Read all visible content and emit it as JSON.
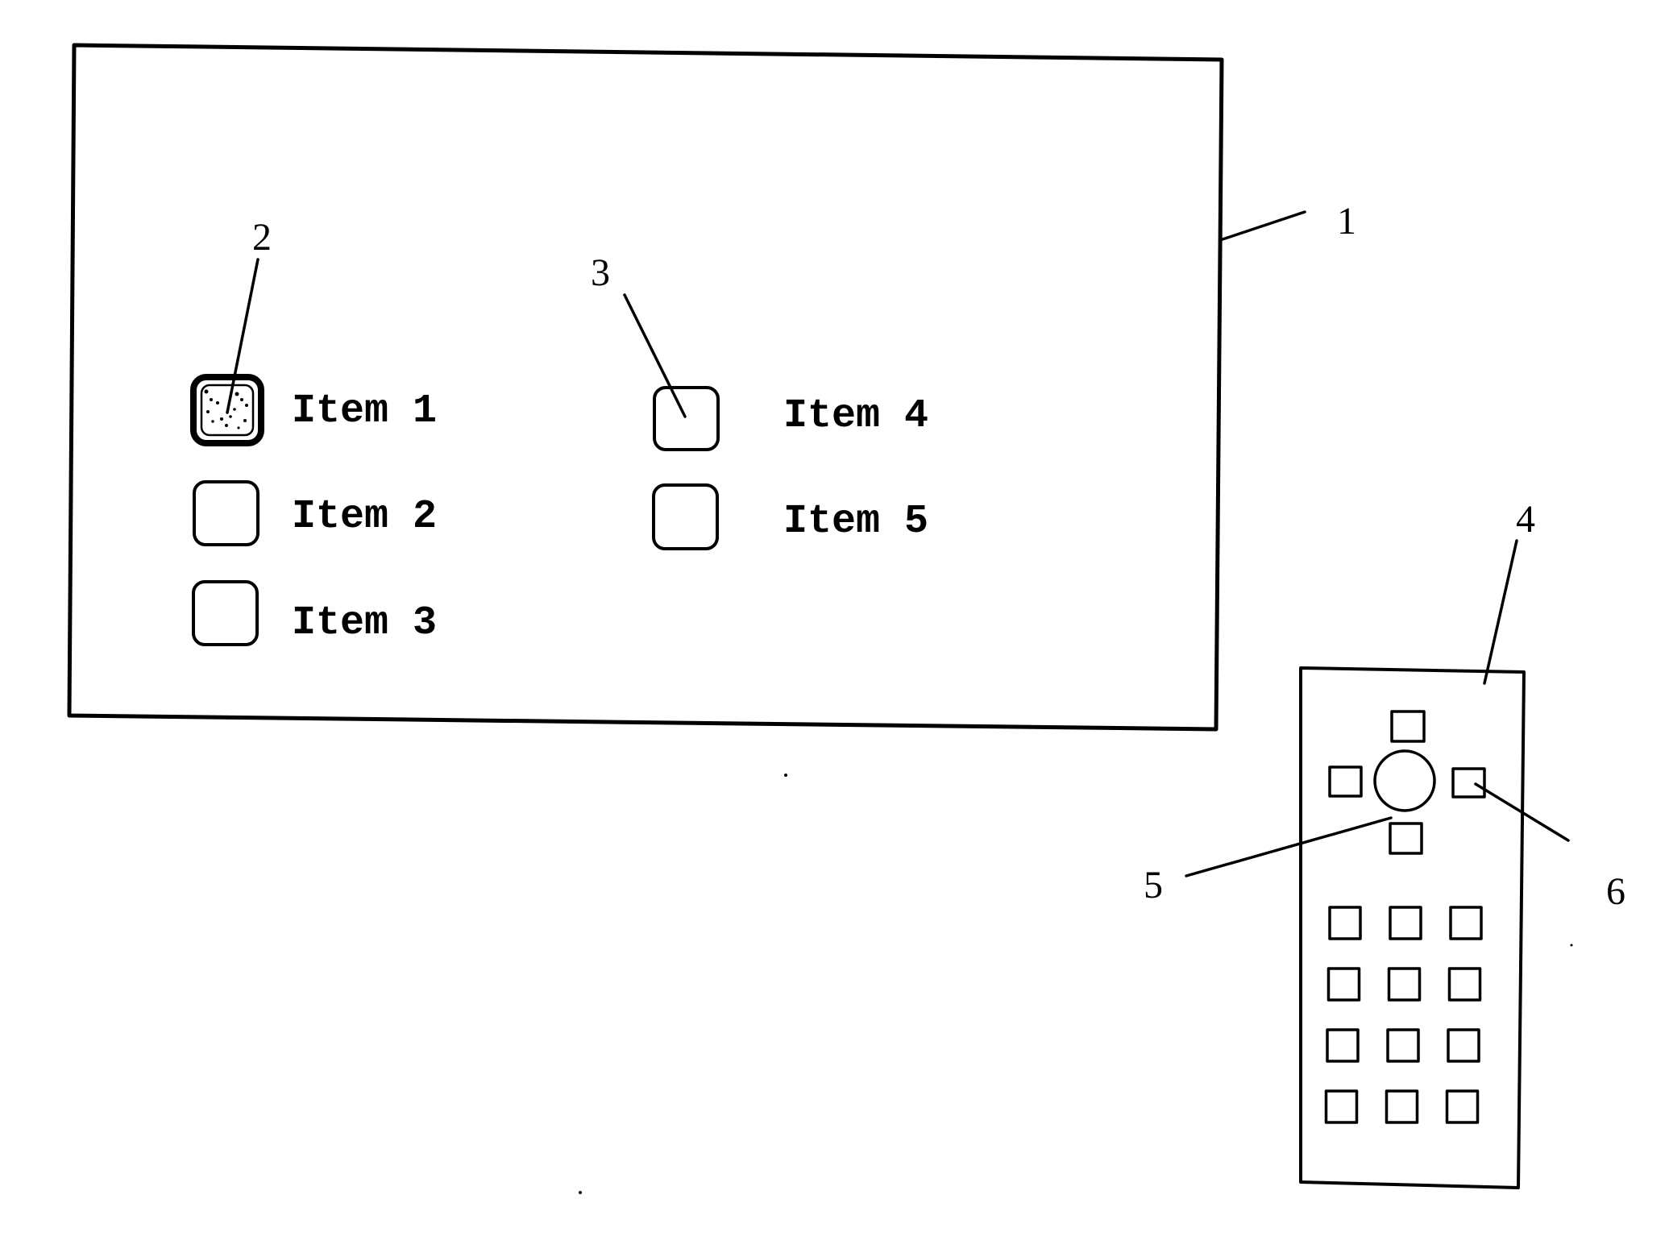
{
  "figure": {
    "type": "patent-drawing",
    "stroke_color": "#000000",
    "background": "#ffffff"
  },
  "screen": {
    "ref": "1",
    "menu_items": [
      {
        "label": "Item 1",
        "selected": true
      },
      {
        "label": "Item 2",
        "selected": false
      },
      {
        "label": "Item 3",
        "selected": false
      },
      {
        "label": "Item 4",
        "selected": false
      },
      {
        "label": "Item 5",
        "selected": false
      }
    ],
    "focused_button_ref": "2",
    "button_ref": "3"
  },
  "remote": {
    "ref": "4",
    "ok_button_ref": "5",
    "arrow_button_ref": "6",
    "dpad": [
      "up",
      "left",
      "ok",
      "right",
      "down"
    ],
    "keypad_rows": 4,
    "keypad_cols": 3
  },
  "reference_numerals": [
    "1",
    "2",
    "3",
    "4",
    "5",
    "6"
  ]
}
